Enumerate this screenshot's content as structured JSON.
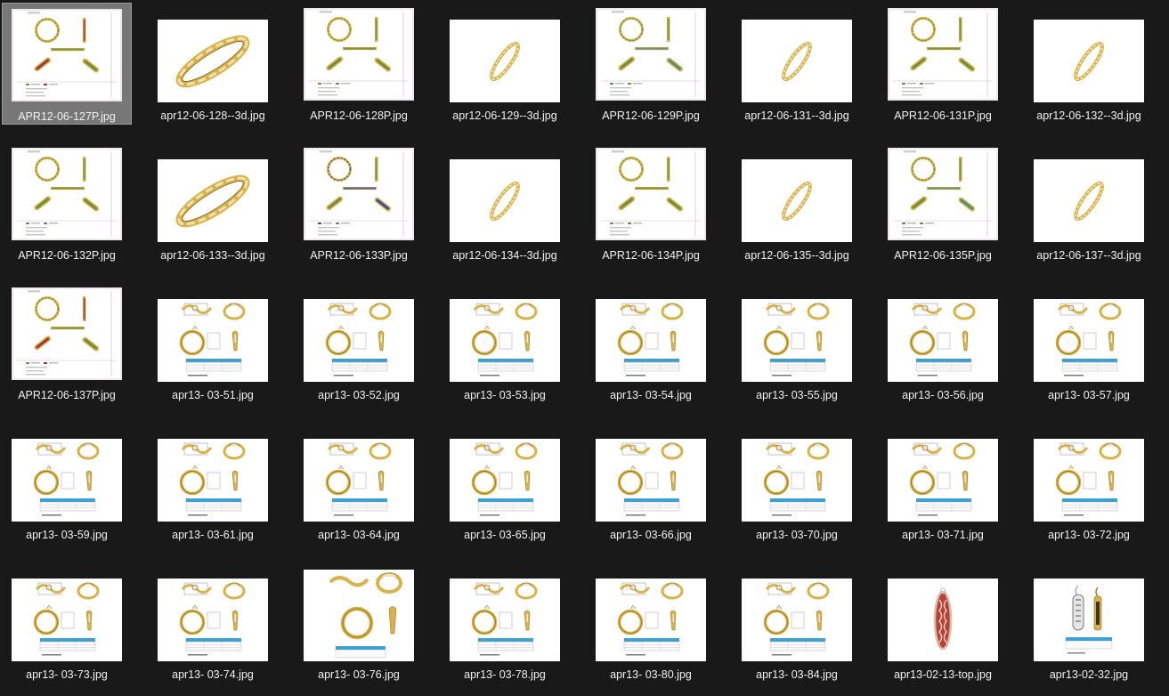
{
  "files": [
    {
      "name": "APR12-06-127P.jpg",
      "kind": "sheet-band-green-red",
      "selected": true
    },
    {
      "name": "apr12-06-128--3d.jpg",
      "kind": "band-3d-large"
    },
    {
      "name": "APR12-06-128P.jpg",
      "kind": "sheet-band-green"
    },
    {
      "name": "apr12-06-129--3d.jpg",
      "kind": "band-3d-small"
    },
    {
      "name": "APR12-06-129P.jpg",
      "kind": "sheet-band-teal"
    },
    {
      "name": "apr12-06-131--3d.jpg",
      "kind": "band-3d-small"
    },
    {
      "name": "APR12-06-131P.jpg",
      "kind": "sheet-band-green"
    },
    {
      "name": "apr12-06-132--3d.jpg",
      "kind": "band-3d-small"
    },
    {
      "name": "APR12-06-132P.jpg",
      "kind": "sheet-band-green"
    },
    {
      "name": "apr12-06-133--3d.jpg",
      "kind": "band-3d-large"
    },
    {
      "name": "APR12-06-133P.jpg",
      "kind": "sheet-band-blue"
    },
    {
      "name": "apr12-06-134--3d.jpg",
      "kind": "band-3d-small"
    },
    {
      "name": "APR12-06-134P.jpg",
      "kind": "sheet-band-green"
    },
    {
      "name": "apr12-06-135--3d.jpg",
      "kind": "band-3d-small"
    },
    {
      "name": "APR12-06-135P.jpg",
      "kind": "sheet-band-teal"
    },
    {
      "name": "apr12-06-137--3d.jpg",
      "kind": "band-3d-small"
    },
    {
      "name": "APR12-06-137P.jpg",
      "kind": "sheet-band-green-red"
    },
    {
      "name": "apr13- 03-51.jpg",
      "kind": "ring-sheet"
    },
    {
      "name": "apr13- 03-52.jpg",
      "kind": "ring-sheet"
    },
    {
      "name": "apr13- 03-53.jpg",
      "kind": "ring-sheet"
    },
    {
      "name": "apr13- 03-54.jpg",
      "kind": "ring-sheet"
    },
    {
      "name": "apr13- 03-55.jpg",
      "kind": "ring-sheet"
    },
    {
      "name": "apr13- 03-56.jpg",
      "kind": "ring-sheet"
    },
    {
      "name": "apr13- 03-57.jpg",
      "kind": "ring-sheet"
    },
    {
      "name": "apr13- 03-59.jpg",
      "kind": "ring-sheet"
    },
    {
      "name": "apr13- 03-61.jpg",
      "kind": "ring-sheet"
    },
    {
      "name": "apr13- 03-64.jpg",
      "kind": "ring-sheet"
    },
    {
      "name": "apr13- 03-65.jpg",
      "kind": "ring-sheet"
    },
    {
      "name": "apr13- 03-66.jpg",
      "kind": "ring-sheet"
    },
    {
      "name": "apr13- 03-70.jpg",
      "kind": "ring-sheet"
    },
    {
      "name": "apr13- 03-71.jpg",
      "kind": "ring-sheet"
    },
    {
      "name": "apr13- 03-72.jpg",
      "kind": "ring-sheet"
    },
    {
      "name": "apr13- 03-73.jpg",
      "kind": "ring-sheet"
    },
    {
      "name": "apr13- 03-74.jpg",
      "kind": "ring-sheet"
    },
    {
      "name": "apr13- 03-76.jpg",
      "kind": "ring-sheet-tall"
    },
    {
      "name": "apr13- 03-78.jpg",
      "kind": "ring-sheet"
    },
    {
      "name": "apr13- 03-80.jpg",
      "kind": "ring-sheet"
    },
    {
      "name": "apr13- 03-84.jpg",
      "kind": "ring-sheet"
    },
    {
      "name": "apr13-02-13-top.jpg",
      "kind": "pendant-red"
    },
    {
      "name": "apr13-02-32.jpg",
      "kind": "earring-sheet"
    }
  ],
  "colors": {
    "background": "#191919",
    "label_text": "#f0f0f0",
    "selected_tile": "#777777",
    "gold": "#d9b24a",
    "gold_dark": "#8c6a1c",
    "stone_green": "#6f8f3a",
    "stone_red": "#9a3a3a",
    "stone_teal": "#4f8f7a",
    "stone_blue": "#3a4f9a",
    "table_blue": "#3aa0d8"
  }
}
